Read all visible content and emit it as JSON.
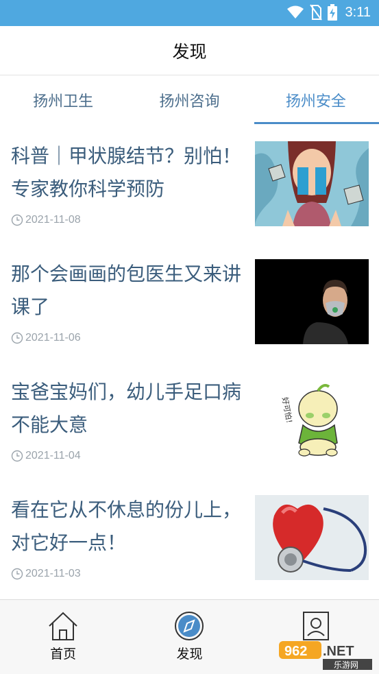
{
  "status_bar": {
    "time": "3:11"
  },
  "header": {
    "title": "发现"
  },
  "tabs": [
    {
      "label": "扬州卫生",
      "active": false
    },
    {
      "label": "扬州咨询",
      "active": false
    },
    {
      "label": "扬州安全",
      "active": true
    }
  ],
  "articles": [
    {
      "title": "科普｜甲状腺结节？别怕！专家教你科学预防",
      "date": "2021-11-08"
    },
    {
      "title": "那个会画画的包医生又来讲课了",
      "date": "2021-11-06"
    },
    {
      "title": "宝爸宝妈们，幼儿手足口病不能大意",
      "date": "2021-11-04",
      "thumb_text": "好可怕！"
    },
    {
      "title": "看在它从不休息的份儿上，对它好一点！",
      "date": "2021-11-03"
    }
  ],
  "bottom_nav": [
    {
      "label": "首页",
      "icon": "home-icon"
    },
    {
      "label": "发现",
      "icon": "compass-icon"
    },
    {
      "label": "我的",
      "icon": "profile-icon"
    }
  ],
  "watermark": {
    "brand": "962.NET",
    "sub": "乐游网"
  },
  "colors": {
    "status_bar": "#4fa8e0",
    "accent": "#4a8cc8",
    "title_text": "#3b5d7c"
  }
}
